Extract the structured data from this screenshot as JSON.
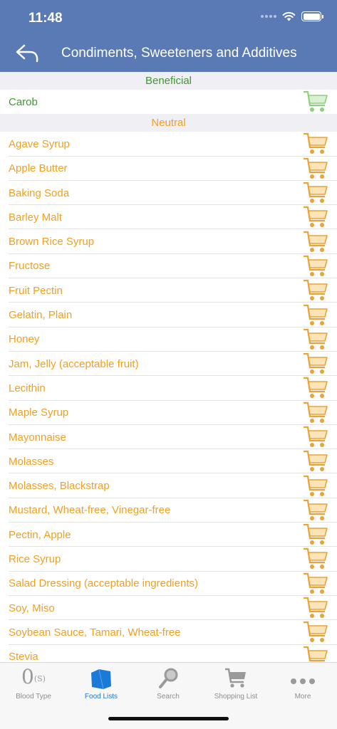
{
  "status": {
    "time": "11:48"
  },
  "nav": {
    "title": "Condiments, Sweeteners and Additives"
  },
  "sections": [
    {
      "title": "Beneficial",
      "tone": "beneficial",
      "items": [
        "Carob"
      ]
    },
    {
      "title": "Neutral",
      "tone": "neutral",
      "items": [
        "Agave Syrup",
        "Apple Butter",
        "Baking Soda",
        "Barley Malt",
        "Brown Rice Syrup",
        "Fructose",
        "Fruit Pectin",
        "Gelatin, Plain",
        "Honey",
        "Jam, Jelly (acceptable fruit)",
        "Lecithin",
        "Maple Syrup",
        "Mayonnaise",
        "Molasses",
        "Molasses, Blackstrap",
        "Mustard, Wheat-free, Vinegar-free",
        "Pectin, Apple",
        "Rice Syrup",
        "Salad Dressing (acceptable ingredients)",
        "Soy, Miso",
        "Soybean Sauce, Tamari, Wheat-free",
        "Stevia"
      ]
    }
  ],
  "colors": {
    "beneficial": "#3d9a2f",
    "neutral": "#f0a020",
    "header": "#5a7ab6",
    "active_tab": "#1a7ad8"
  },
  "tabs": [
    {
      "label": "Blood Type",
      "icon": "blood-type-icon",
      "icon_text": "0",
      "icon_sub": "(S)",
      "active": false
    },
    {
      "label": "Food Lists",
      "icon": "food-lists-icon",
      "active": true
    },
    {
      "label": "Search",
      "icon": "search-icon",
      "active": false
    },
    {
      "label": "Shopping List",
      "icon": "cart-icon",
      "active": false
    },
    {
      "label": "More",
      "icon": "more-icon",
      "active": false
    }
  ]
}
